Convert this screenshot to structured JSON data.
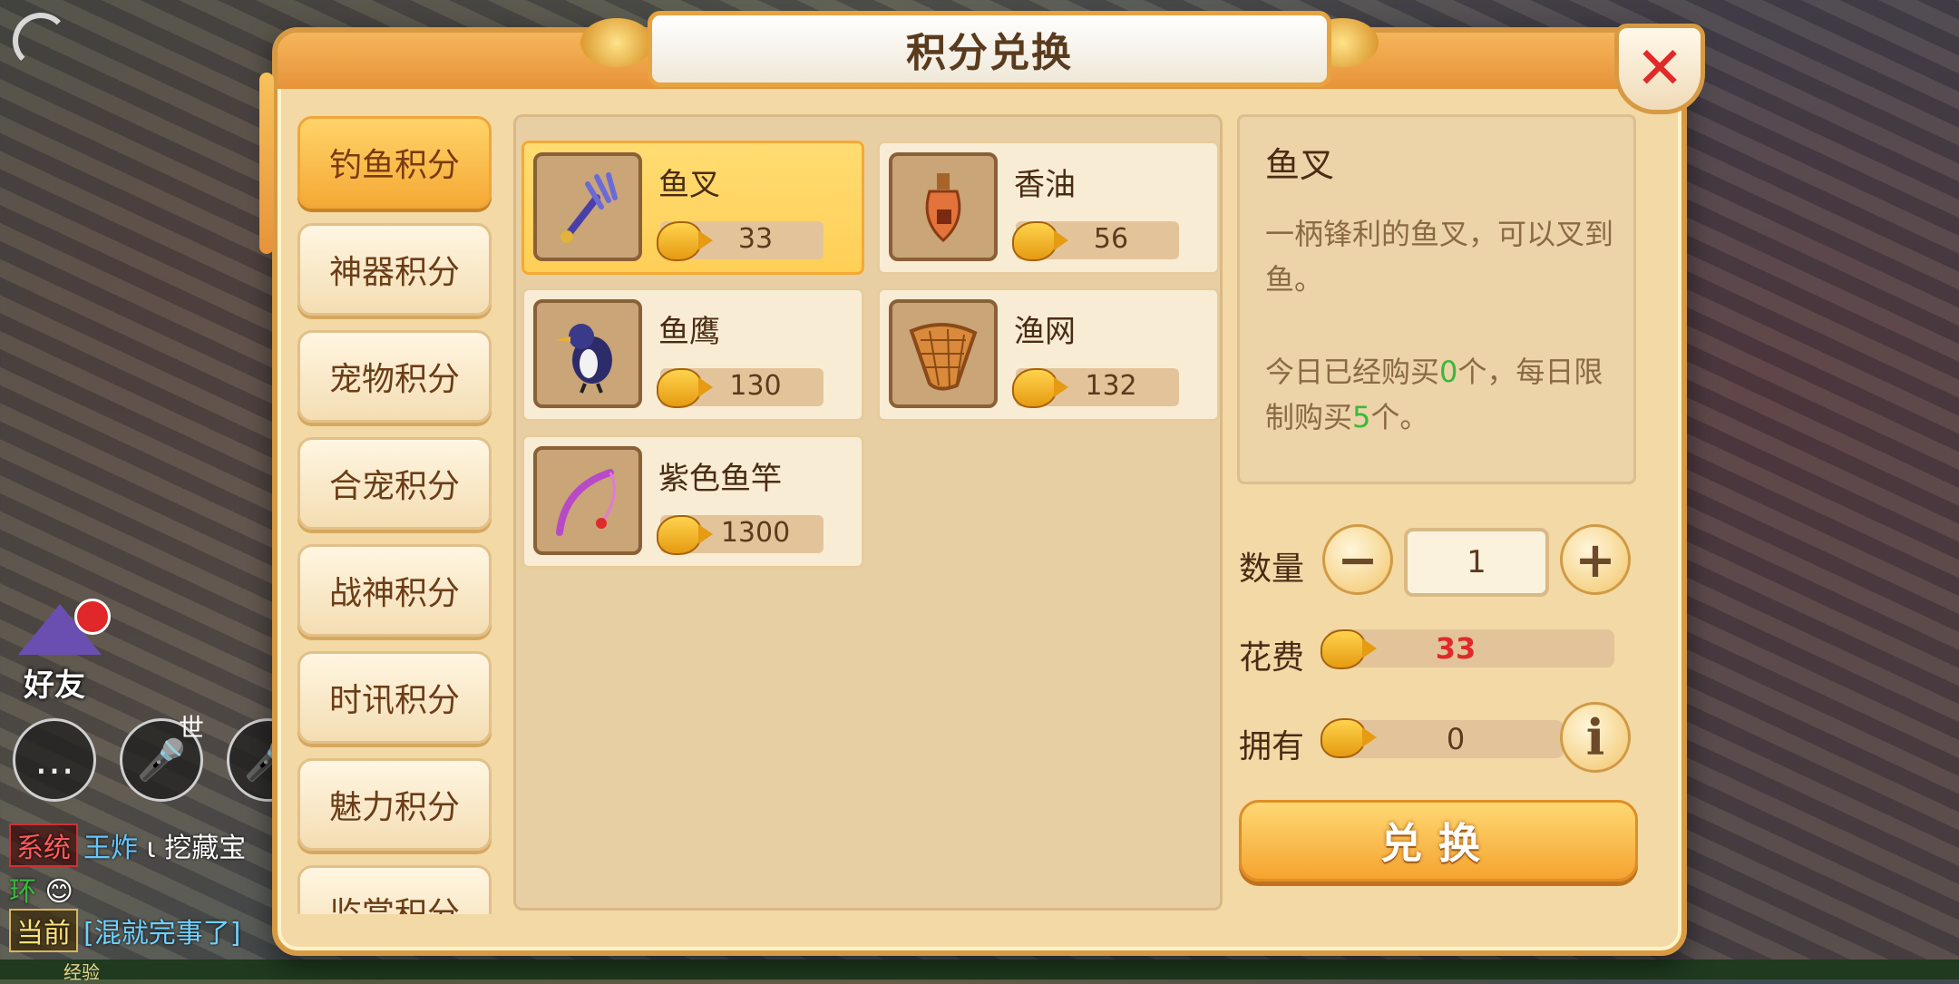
{
  "colors": {
    "accent": "#f5a935",
    "green": "#3bb83b",
    "red": "#e02a2a"
  },
  "panel": {
    "title": "积分兑换",
    "close_icon": "✕"
  },
  "tabs": [
    {
      "label": "钓鱼积分",
      "active": true
    },
    {
      "label": "神器积分"
    },
    {
      "label": "宠物积分"
    },
    {
      "label": "合宠积分"
    },
    {
      "label": "战神积分"
    },
    {
      "label": "时讯积分"
    },
    {
      "label": "魅力积分"
    },
    {
      "label": "监赏积分"
    }
  ],
  "items": [
    {
      "name": "鱼叉",
      "price": "33",
      "icon": "trident-icon",
      "selected": true
    },
    {
      "name": "香油",
      "price": "56",
      "icon": "oil-bottle-icon"
    },
    {
      "name": "鱼鹰",
      "price": "130",
      "icon": "cormorant-icon"
    },
    {
      "name": "渔网",
      "price": "132",
      "icon": "fishing-net-icon"
    },
    {
      "name": "紫色鱼竿",
      "price": "1300",
      "icon": "fishing-rod-icon"
    }
  ],
  "detail": {
    "name": "鱼叉",
    "description": "一柄锋利的鱼叉，可以叉到鱼。",
    "limit_prefix": "今日已经购买",
    "limit_bought": "0",
    "limit_mid": "个，每日限制购买",
    "limit_max": "5",
    "limit_suffix": "个。"
  },
  "quantity": {
    "label": "数量",
    "value": "1",
    "minus": "−",
    "plus": "+"
  },
  "cost": {
    "label": "花费",
    "value": "33"
  },
  "owned": {
    "label": "拥有",
    "value": "0",
    "info": "i"
  },
  "exchange_button": "兑换",
  "hud": {
    "friend_label": "好友",
    "world_label": "世",
    "chat": {
      "system_tag": "系统",
      "system_name": "王炸",
      "system_text": "挖藏宝",
      "current_tag": "当前",
      "current_text": "[混就完事了]",
      "misc": "环"
    },
    "bottom_text": "经验"
  }
}
